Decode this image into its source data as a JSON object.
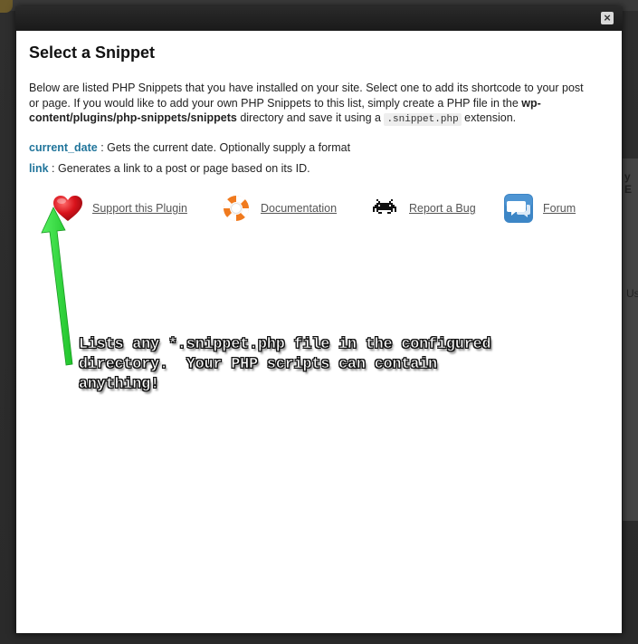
{
  "background": {
    "right_text_1": "y E",
    "right_text_2": "Us"
  },
  "modal": {
    "close_label": "×",
    "title": "Select a Snippet",
    "intro": {
      "part1": "Below are listed PHP Snippets that you have installed on your site. Select one to add its shortcode to your post or page. If you would like to add your own PHP Snippets to this list, simply create a PHP file in the ",
      "path": "wp-content/plugins/php-snippets/snippets",
      "part2": " directory and save it using a ",
      "extension": ".snippet.php",
      "part3": " extension."
    },
    "snippets": [
      {
        "name": "current_date",
        "description": " : Gets the current date. Optionally supply a format"
      },
      {
        "name": "link",
        "description": " : Generates a link to a post or page based on its ID."
      }
    ],
    "links": {
      "support": "Support this Plugin",
      "documentation": "Documentation",
      "bug": "Report a Bug",
      "forum": "Forum"
    }
  },
  "annotation": {
    "text": "Lists any *.snippet.php file in the configured\ndirectory.  Your PHP scripts can contain\nanything!"
  },
  "colors": {
    "link_blue": "#21759b",
    "arrow_green": "#22dd33",
    "heart_red": "#d8121b",
    "lifebuoy_orange": "#f07a1e",
    "forum_blue": "#3d86c6"
  }
}
